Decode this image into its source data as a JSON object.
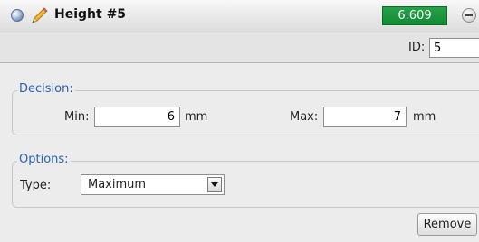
{
  "header": {
    "title": "Height #5",
    "value": "6.609",
    "status_icon": "status-dot-icon",
    "edit_icon": "pencil-icon",
    "collapse_icon": "minus-circle-icon",
    "value_color": "#1a9640"
  },
  "id": {
    "label": "ID:",
    "value": "5"
  },
  "decision": {
    "legend": "Decision:",
    "min_label": "Min:",
    "min_value": "6",
    "max_label": "Max:",
    "max_value": "7",
    "unit": "mm"
  },
  "options": {
    "legend": "Options:",
    "type_label": "Type:",
    "type_value": "Maximum"
  },
  "actions": {
    "remove_label": "Remove"
  },
  "accent_color": "#2b60b5"
}
